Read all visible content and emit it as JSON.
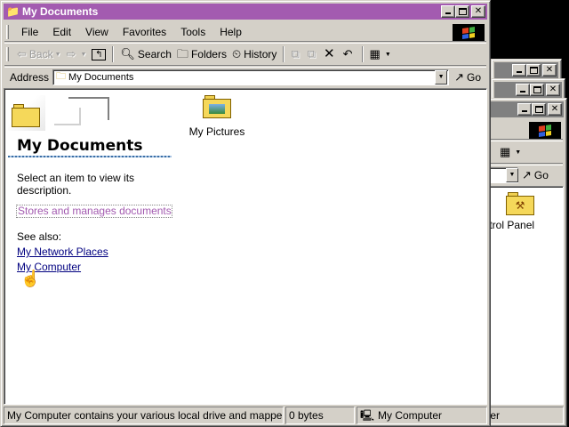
{
  "colors": {
    "active_title": "#a35bb0",
    "inactive_title": "#808080",
    "link": "#000080",
    "tip": "#a35bb0"
  },
  "back_window_3": {
    "title": ""
  },
  "back_window_2": {
    "title": ""
  },
  "control_panel_window": {
    "toolbar_view_icon": "views-icon",
    "go_label": "Go",
    "item_label": "ontrol Panel",
    "status_text": "ter"
  },
  "main_window": {
    "title": "My Documents",
    "menu": [
      "File",
      "Edit",
      "View",
      "Favorites",
      "Tools",
      "Help"
    ],
    "toolbar": {
      "back": "Back",
      "search": "Search",
      "folders": "Folders",
      "history": "History"
    },
    "address": {
      "label": "Address",
      "value": "My Documents",
      "go": "Go"
    },
    "left_pane": {
      "heading": "My Documents",
      "description": "Select an item to view its description.",
      "tip": "Stores and manages documents",
      "see_also": "See also:",
      "links": [
        "My Network Places",
        "My Computer"
      ]
    },
    "items": [
      {
        "label": "My Pictures",
        "icon": "pictures-folder-icon"
      }
    ],
    "status": {
      "message": "My Computer contains your various local drive and mapped netw",
      "size": "0 bytes",
      "zone": "My Computer"
    }
  }
}
